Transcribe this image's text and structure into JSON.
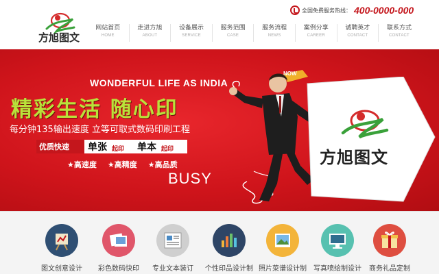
{
  "header": {
    "brand": "方旭图文",
    "hotline_label": "全国免费服务热线：",
    "hotline_number": "400-0000-000",
    "nav": [
      {
        "cn": "网站首页",
        "en": "HOME"
      },
      {
        "cn": "走进方旭",
        "en": "ABOUT"
      },
      {
        "cn": "设备展示",
        "en": "SERVICE"
      },
      {
        "cn": "服务范围",
        "en": "CASE"
      },
      {
        "cn": "服务流程",
        "en": "NEWS"
      },
      {
        "cn": "案例分享",
        "en": "CAREER"
      },
      {
        "cn": "诚聘英才",
        "en": "CONTACT"
      },
      {
        "cn": "联系方式",
        "en": "CONTACT"
      }
    ]
  },
  "banner": {
    "tagline_en": "WONDERFUL LIFE AS INDIA",
    "now_badge": "NOW",
    "slogan": "精彩生活  随心印",
    "subline": "每分钟135输出速度  立等可取式数码印刷工程",
    "quality_badge": "优质快速",
    "option1_big": "单张",
    "option1_small": "起印",
    "option2_big": "单本",
    "option2_small": "起印",
    "features": [
      "★高速度",
      "★高精度",
      "★高品质"
    ],
    "busy": "BUSY",
    "sign_brand": "方旭图文"
  },
  "services": [
    {
      "label": "图文创意设计",
      "icon": "easel-chart-icon",
      "color": "#2f4f73"
    },
    {
      "label": "彩色数码快印",
      "icon": "photo-prints-icon",
      "color": "#e0566a"
    },
    {
      "label": "专业文本装订",
      "icon": "document-binding-icon",
      "color": "#cfcfcf"
    },
    {
      "label": "个性印品设计制",
      "icon": "equalizer-bars-icon",
      "color": "#2e4566"
    },
    {
      "label": "照片菜谱设计制",
      "icon": "picture-frame-icon",
      "color": "#f3b43a"
    },
    {
      "label": "写真喷绘制设计",
      "icon": "monitor-display-icon",
      "color": "#57c1b0"
    },
    {
      "label": "商务礼品定制",
      "icon": "gift-box-icon",
      "color": "#de4e40"
    }
  ],
  "colors": {
    "brand_red": "#c4161c",
    "slogan_green": "#b9e23a",
    "banner_red": "#d41a20"
  }
}
